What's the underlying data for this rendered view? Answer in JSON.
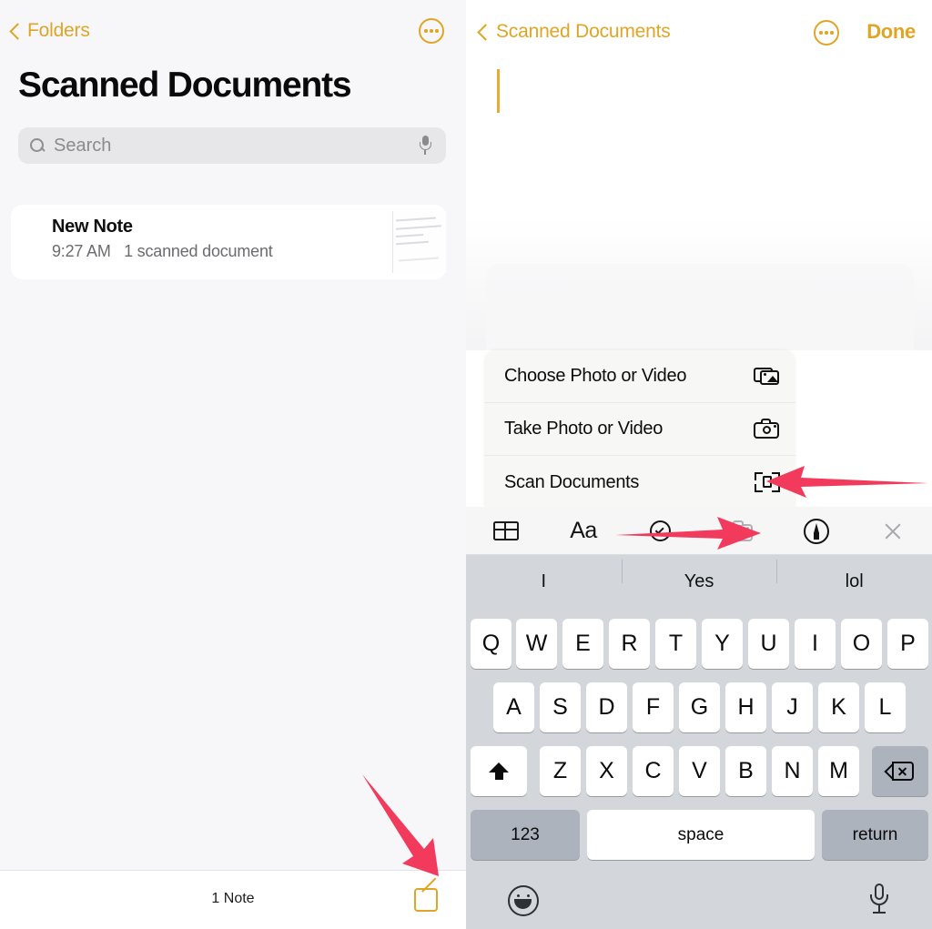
{
  "theme": {
    "accent": "#e0a526",
    "arrow_color": "#f23a5c",
    "keyboard_bg": "#d3d6db"
  },
  "left_pane": {
    "back_label": "Folders",
    "back_icon": "chevron-left-icon",
    "more_icon": "ellipsis-circle-icon",
    "title": "Scanned Documents",
    "search": {
      "placeholder": "Search",
      "icon": "search-icon",
      "mic_icon": "microphone-icon"
    },
    "notes": [
      {
        "title": "New Note",
        "time": "9:27 AM",
        "detail": "1 scanned document",
        "thumbnail": "scanned-page-thumbnail"
      }
    ],
    "bottom_bar": {
      "count_label": "1 Note",
      "compose_icon": "compose-note-icon"
    }
  },
  "right_pane": {
    "back_label": "Scanned Documents",
    "back_icon": "chevron-left-icon",
    "more_icon": "ellipsis-circle-icon",
    "done_label": "Done",
    "note_body": "",
    "action_sheet": {
      "items": [
        {
          "label": "Choose Photo or Video",
          "icon": "photo-library-icon"
        },
        {
          "label": "Take Photo or Video",
          "icon": "camera-icon"
        },
        {
          "label": "Scan Documents",
          "icon": "scan-documents-icon"
        }
      ]
    },
    "format_toolbar": {
      "items": [
        {
          "name": "table-icon",
          "label": ""
        },
        {
          "name": "text-format-icon",
          "label": "Aa"
        },
        {
          "name": "checklist-icon",
          "label": ""
        },
        {
          "name": "camera-icon",
          "label": ""
        },
        {
          "name": "markup-pen-icon",
          "label": ""
        },
        {
          "name": "close-icon",
          "label": ""
        }
      ]
    },
    "keyboard": {
      "predictions": [
        "I",
        "Yes",
        "lol"
      ],
      "row1": [
        "Q",
        "W",
        "E",
        "R",
        "T",
        "Y",
        "U",
        "I",
        "O",
        "P"
      ],
      "row2": [
        "A",
        "S",
        "D",
        "F",
        "G",
        "H",
        "J",
        "K",
        "L"
      ],
      "row3": [
        "Z",
        "X",
        "C",
        "V",
        "B",
        "N",
        "M"
      ],
      "shift_icon": "shift-icon",
      "delete_icon": "backspace-icon",
      "numbers_label": "123",
      "space_label": "space",
      "return_label": "return",
      "emoji_icon": "emoji-smiley-icon",
      "dictation_icon": "microphone-icon"
    }
  },
  "annotations": [
    {
      "name": "arrow-to-scan-documents",
      "direction": "left"
    },
    {
      "name": "arrow-to-camera-toolbar",
      "direction": "right"
    },
    {
      "name": "arrow-to-compose-button",
      "direction": "down-right"
    }
  ]
}
